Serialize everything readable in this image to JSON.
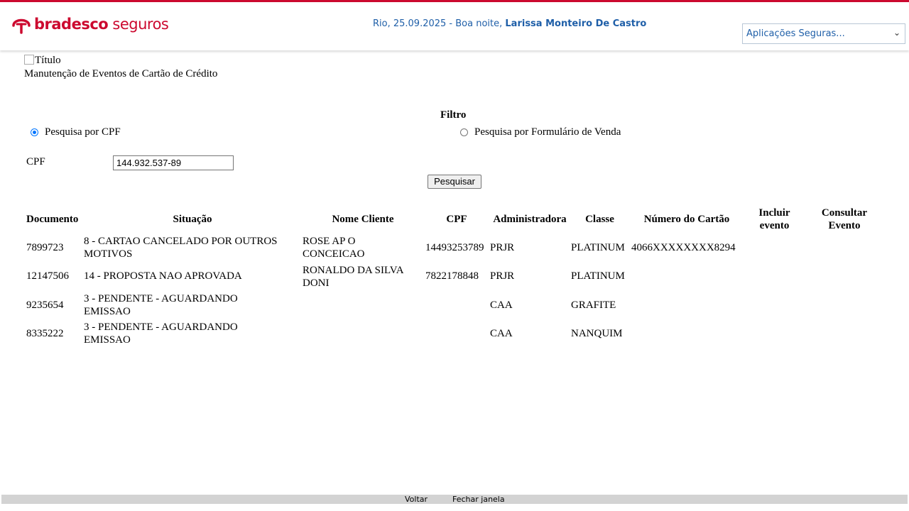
{
  "header": {
    "logo_bold": "bradesco",
    "logo_light": " seguros",
    "greeting": "Rio, 25.09.2025 - Boa noite, ",
    "user": "Larissa Monteiro De Castro",
    "app_select": "Aplicações Seguras...",
    "colors": {
      "brand": "#cc092f",
      "link": "#1f5fa8"
    }
  },
  "page": {
    "title_alt": "Título",
    "subtitle": "Manutenção de Eventos de Cartão de Crédito"
  },
  "filter": {
    "title": "Filtro",
    "option_cpf": "Pesquisa por CPF",
    "option_form": "Pesquisa por Formulário de Venda",
    "selected": "cpf",
    "cpf_label": "CPF",
    "cpf_value": "144.932.537-89",
    "search_button": "Pesquisar"
  },
  "table": {
    "headers": {
      "documento": "Documento",
      "situacao": "Situação",
      "nome": "Nome Cliente",
      "cpf": "CPF",
      "administradora": "Administradora",
      "classe": "Classe",
      "numero": "Número do Cartão",
      "incluir_1": "Incluir",
      "incluir_2": "evento",
      "consultar_1": "Consultar",
      "consultar_2": "Evento"
    },
    "rows": [
      {
        "documento": "7899723",
        "situacao_1": "8 - CARTAO CANCELADO POR OUTROS",
        "situacao_2": "MOTIVOS",
        "nome_1": "ROSE AP O",
        "nome_2": "CONCEICAO",
        "cpf": "14493253789",
        "administradora": "PRJR",
        "classe": "PLATINUM",
        "numero": "4066XXXXXXXX8294"
      },
      {
        "documento": "12147506",
        "situacao_1": "14 - PROPOSTA NAO APROVADA",
        "situacao_2": "",
        "nome_1": "RONALDO DA SILVA",
        "nome_2": "DONI",
        "cpf": "7822178848",
        "administradora": "PRJR",
        "classe": "PLATINUM",
        "numero": ""
      },
      {
        "documento": "9235654",
        "situacao_1": "3 - PENDENTE - AGUARDANDO",
        "situacao_2": "EMISSAO",
        "nome_1": "",
        "nome_2": "",
        "cpf": "",
        "administradora": "CAA",
        "classe": "GRAFITE",
        "numero": ""
      },
      {
        "documento": "8335222",
        "situacao_1": "3 - PENDENTE - AGUARDANDO",
        "situacao_2": "EMISSAO",
        "nome_1": "",
        "nome_2": "",
        "cpf": "",
        "administradora": "CAA",
        "classe": "NANQUIM",
        "numero": ""
      }
    ]
  },
  "footer": {
    "back": "Voltar",
    "close": "Fechar janela"
  }
}
